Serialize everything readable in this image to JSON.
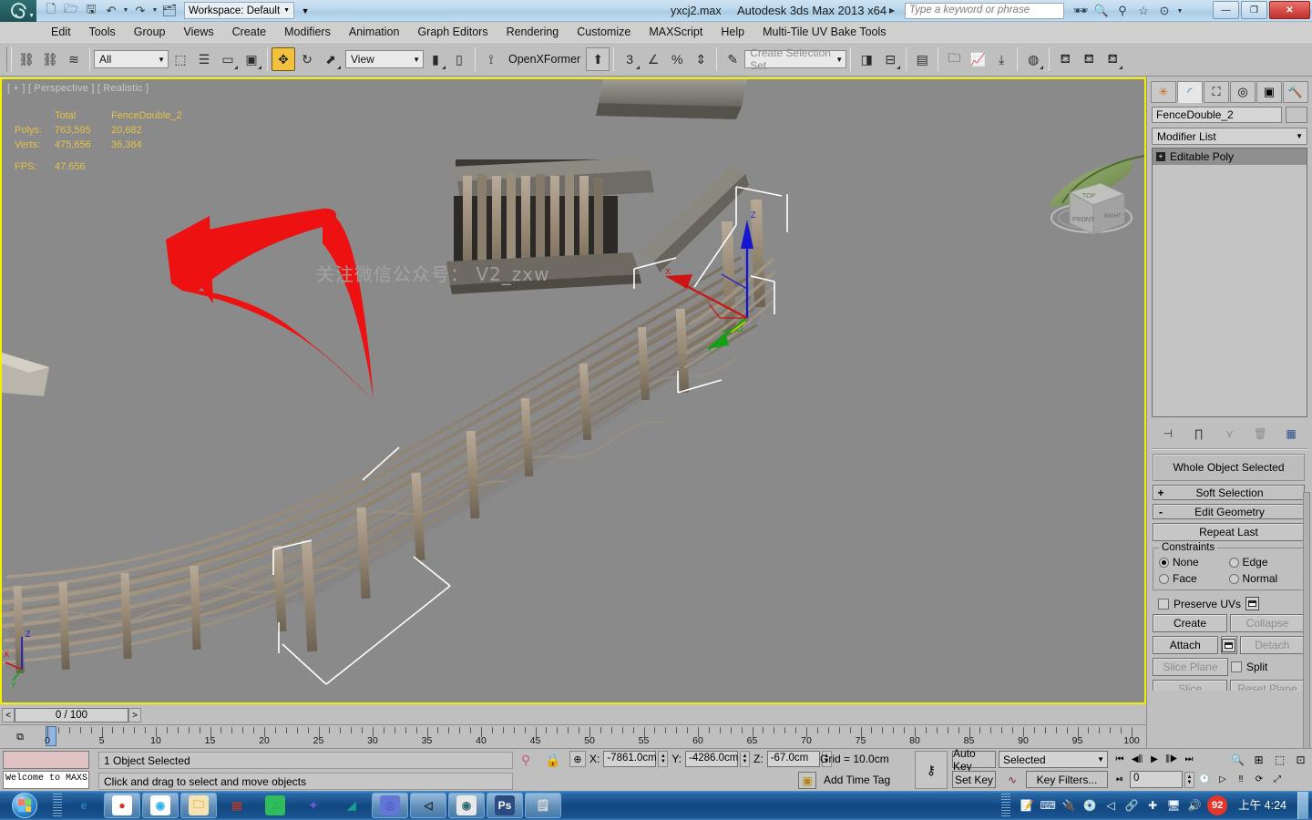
{
  "titlebar": {
    "app_title": "Autodesk 3ds Max  2013 x64",
    "file_name": "yxcj2.max",
    "workspace_label": "Workspace: Default",
    "search_placeholder": "Type a keyword or phrase",
    "quick_access": [
      {
        "name": "new-file-icon",
        "glyph": "🗋"
      },
      {
        "name": "open-file-icon",
        "glyph": "🗁"
      },
      {
        "name": "save-file-icon",
        "glyph": "🖫"
      },
      {
        "name": "undo-icon",
        "glyph": "↶"
      },
      {
        "name": "redo-icon",
        "glyph": "↷"
      },
      {
        "name": "project-folder-icon",
        "glyph": "🗂"
      }
    ],
    "title_icons": [
      {
        "name": "search-binoculars-icon",
        "glyph": "🔭"
      },
      {
        "name": "magnifier-icon",
        "glyph": "🔍"
      },
      {
        "name": "compass-icon",
        "glyph": "⚲"
      },
      {
        "name": "favorites-star-icon",
        "glyph": "☆"
      },
      {
        "name": "help-icon",
        "glyph": "?"
      }
    ],
    "window_buttons": [
      {
        "name": "minimize-button",
        "glyph": "—"
      },
      {
        "name": "restore-button",
        "glyph": "❐"
      },
      {
        "name": "close-button",
        "glyph": "✕"
      }
    ]
  },
  "menubar": {
    "items": [
      "Edit",
      "Tools",
      "Group",
      "Views",
      "Create",
      "Modifiers",
      "Animation",
      "Graph Editors",
      "Rendering",
      "Customize",
      "MAXScript",
      "Help",
      "Multi-Tile UV Bake Tools"
    ]
  },
  "toolbar": {
    "selection_filter": "All",
    "reference_coord_system": "View",
    "named_selection_set_placeholder": "Create Selection Set",
    "openxformer_label": "OpenXFormer",
    "buttons": [
      {
        "name": "select-and-link-icon",
        "glyph": "⛓"
      },
      {
        "name": "unlink-selection-icon",
        "glyph": "⛓"
      },
      {
        "name": "bind-to-space-warp-icon",
        "glyph": "≋"
      },
      {
        "name": "select-object-icon",
        "glyph": "⬜"
      },
      {
        "name": "select-by-name-icon",
        "glyph": "☰"
      },
      {
        "name": "rectangular-selection-region-icon",
        "glyph": "▭"
      },
      {
        "name": "window-crossing-icon",
        "glyph": "▣"
      },
      {
        "name": "select-and-move-icon",
        "glyph": "✥"
      },
      {
        "name": "select-and-rotate-icon",
        "glyph": "↻"
      },
      {
        "name": "select-and-scale-icon",
        "glyph": "⬈"
      },
      {
        "name": "use-pivot-point-center-icon",
        "glyph": "▮"
      },
      {
        "name": "snaps-toggle-3d-icon",
        "glyph": "3"
      },
      {
        "name": "angle-snap-toggle-icon",
        "glyph": "∠"
      },
      {
        "name": "percent-snap-toggle-icon",
        "glyph": "%"
      },
      {
        "name": "spinner-snap-toggle-icon",
        "glyph": "⇕"
      },
      {
        "name": "edit-named-selection-sets-icon",
        "glyph": "{}"
      },
      {
        "name": "mirror-icon",
        "glyph": "◨"
      },
      {
        "name": "align-icon",
        "glyph": "⊟"
      },
      {
        "name": "layer-manager-icon",
        "glyph": "▤"
      },
      {
        "name": "toggle-scene-explorer-icon",
        "glyph": "🗀"
      },
      {
        "name": "curve-editor-icon",
        "glyph": "📈"
      },
      {
        "name": "schematic-view-icon",
        "glyph": "⤓"
      },
      {
        "name": "material-editor-icon",
        "glyph": "◍"
      },
      {
        "name": "render-setup-icon",
        "glyph": "🫖"
      },
      {
        "name": "rendered-frame-window-icon",
        "glyph": "🫖"
      },
      {
        "name": "render-production-icon",
        "glyph": "🫖"
      }
    ]
  },
  "viewport": {
    "label": "[ + ] [ Perspective ] [ Realistic ]",
    "stats": {
      "col_headers": [
        "",
        "Total",
        "FenceDouble_2"
      ],
      "rows": [
        {
          "label": "Polys:",
          "total": "763,595",
          "selected": "20,682"
        },
        {
          "label": "Verts:",
          "total": "475,656",
          "selected": "36,384"
        }
      ],
      "fps_label": "FPS:",
      "fps_value": "47.656"
    },
    "watermark": "关注微信公众号： V2_zxw",
    "gizmo_axis_labels": {
      "x": "X",
      "y": "Y",
      "z": "Z"
    },
    "viewcube_faces": {
      "top": "TOP",
      "front": "FRONT",
      "right": "RIGHT"
    },
    "colors": {
      "background": "#8a8a8a",
      "border_active": "#f2f200",
      "stats_text": "#e4c14a",
      "axis_x": "#cc2222",
      "axis_y": "#1f9e1f",
      "axis_z": "#2222cc"
    }
  },
  "command_panel": {
    "tabs": [
      {
        "name": "create-tab",
        "glyph": "✳",
        "active": false
      },
      {
        "name": "modify-tab",
        "glyph": "◜",
        "active": true
      },
      {
        "name": "hierarchy-tab",
        "glyph": "⛶",
        "active": false
      },
      {
        "name": "motion-tab",
        "glyph": "◎",
        "active": false
      },
      {
        "name": "display-tab",
        "glyph": "▣",
        "active": false
      },
      {
        "name": "utilities-tab",
        "glyph": "🔨",
        "active": false
      }
    ],
    "object_name": "FenceDouble_2",
    "modifier_list_label": "Modifier List",
    "modifier_stack": [
      {
        "label": "Editable Poly"
      }
    ],
    "stack_buttons": [
      {
        "name": "pin-stack-icon",
        "glyph": "⊣"
      },
      {
        "name": "show-end-result-icon",
        "glyph": "⑂"
      },
      {
        "name": "make-unique-icon",
        "glyph": "⋎"
      },
      {
        "name": "remove-modifier-icon",
        "glyph": "🗑"
      },
      {
        "name": "configure-modifier-sets-icon",
        "glyph": "▦"
      }
    ],
    "selection_status": "Whole Object Selected",
    "rollouts": [
      {
        "name": "soft-selection",
        "sign": "+",
        "title": "Soft Selection"
      },
      {
        "name": "edit-geometry",
        "sign": "-",
        "title": "Edit Geometry"
      }
    ],
    "repeat_last": "Repeat Last",
    "constraints": {
      "legend": "Constraints",
      "options": [
        {
          "label": "None",
          "selected": true
        },
        {
          "label": "Edge",
          "selected": false
        },
        {
          "label": "Face",
          "selected": false
        },
        {
          "label": "Normal",
          "selected": false
        }
      ]
    },
    "preserve_uvs": {
      "label": "Preserve UVs",
      "checked": false
    },
    "buttons": {
      "create": "Create",
      "collapse": "Collapse",
      "attach": "Attach",
      "detach": "Detach",
      "slice_plane": "Slice Plane",
      "split": "Split",
      "slice": "Slice",
      "reset_plane": "Reset Plane"
    }
  },
  "time_slider": {
    "current": "0 / 100",
    "prev_glyph": "<",
    "next_glyph": ">",
    "ruler_ticks": [
      0,
      5,
      10,
      15,
      20,
      25,
      30,
      35,
      40,
      45,
      50,
      55,
      60,
      65,
      70,
      75,
      80,
      85,
      90,
      95,
      100
    ]
  },
  "status_bar": {
    "maxscript_listener_text": "Welcome to MAXS",
    "selection_status": "1 Object Selected",
    "prompt": "Click and drag to select and move objects",
    "coords": [
      {
        "axis": "X:",
        "value": "-7861.0cm"
      },
      {
        "axis": "Y:",
        "value": "-4286.0cm"
      },
      {
        "axis": "Z:",
        "value": "-67.0cm"
      }
    ],
    "grid": "Grid = 10.0cm",
    "add_time_tag": "Add Time Tag",
    "auto_key": "Auto Key",
    "set_key": "Set Key",
    "key_mode_selection": "Selected",
    "key_filters": "Key Filters...",
    "frame_field": "0",
    "playback_buttons": [
      {
        "name": "go-to-start-button",
        "glyph": "⏮"
      },
      {
        "name": "previous-frame-button",
        "glyph": "◁|"
      },
      {
        "name": "play-animation-button",
        "glyph": "▶"
      },
      {
        "name": "next-frame-button",
        "glyph": "|▷"
      },
      {
        "name": "go-to-end-button",
        "glyph": "⏭"
      }
    ],
    "nav_buttons": [
      {
        "name": "zoom-button",
        "glyph": "🔍"
      },
      {
        "name": "zoom-all-button",
        "glyph": "⊞"
      },
      {
        "name": "zoom-extents-button",
        "glyph": "⬚"
      },
      {
        "name": "zoom-region-button",
        "glyph": "⊡"
      },
      {
        "name": "pan-view-button",
        "glyph": "✋"
      },
      {
        "name": "orbit-button",
        "glyph": "⟳"
      },
      {
        "name": "maximize-viewport-button",
        "glyph": "⤡"
      }
    ]
  },
  "taskbar": {
    "start_label": "Start",
    "apps": [
      {
        "name": "taskbar-internet-explorer",
        "glyph": "e",
        "color": "#2a7fc9",
        "bg": "transparent",
        "pinned": false
      },
      {
        "name": "taskbar-google-chrome",
        "glyph": "●",
        "color": "#d93025",
        "bg": "#ffffff",
        "pinned": true
      },
      {
        "name": "taskbar-360-browser",
        "glyph": "◉",
        "color": "#2eb3e8",
        "bg": "#ffffff",
        "pinned": true
      },
      {
        "name": "taskbar-file-explorer",
        "glyph": "🗀",
        "color": "#e8b44a",
        "bg": "#f6e3b4",
        "pinned": true
      },
      {
        "name": "taskbar-winrar",
        "glyph": "▤",
        "color": "#b03a2e",
        "bg": "transparent",
        "pinned": false
      },
      {
        "name": "taskbar-qq-music",
        "glyph": "♫",
        "color": "#1fae4c",
        "bg": "#2fbc5c",
        "pinned": false
      },
      {
        "name": "taskbar-foxmail",
        "glyph": "✦",
        "color": "#6b5bd6",
        "bg": "transparent",
        "pinned": false
      },
      {
        "name": "taskbar-green-app",
        "glyph": "◢",
        "color": "#1a9e8f",
        "bg": "transparent",
        "pinned": false
      },
      {
        "name": "taskbar-ide-app",
        "glyph": "◎",
        "color": "#4b5fc9",
        "bg": "#6477d6",
        "pinned": true
      },
      {
        "name": "taskbar-unity",
        "glyph": "◁",
        "color": "#222222",
        "bg": "transparent",
        "pinned": true
      },
      {
        "name": "taskbar-3dsmax",
        "glyph": "◉",
        "color": "#2e6f73",
        "bg": "#e8e8e8",
        "pinned": true
      },
      {
        "name": "taskbar-photoshop",
        "glyph": "Ps",
        "color": "#ffffff",
        "bg": "#2b4a82",
        "pinned": true
      },
      {
        "name": "taskbar-notepad",
        "glyph": "🗒",
        "color": "#d8d8d8",
        "bg": "transparent",
        "pinned": true
      }
    ],
    "tray": [
      {
        "name": "tray-note-icon",
        "glyph": "📝"
      },
      {
        "name": "tray-keyboard-icon",
        "glyph": "⌨"
      },
      {
        "name": "tray-usb-icon",
        "glyph": "🔌"
      },
      {
        "name": "tray-disc-icon",
        "glyph": "💿"
      },
      {
        "name": "tray-unity-icon",
        "glyph": "◁"
      },
      {
        "name": "tray-network-ok-icon",
        "glyph": "🔗"
      },
      {
        "name": "tray-plus-icon",
        "glyph": "✚"
      },
      {
        "name": "tray-monitor-icon",
        "glyph": "🖥"
      },
      {
        "name": "tray-volume-icon",
        "glyph": "🔊"
      }
    ],
    "badge_count": "92",
    "clock_period": "上午",
    "clock_time": "4:24"
  }
}
